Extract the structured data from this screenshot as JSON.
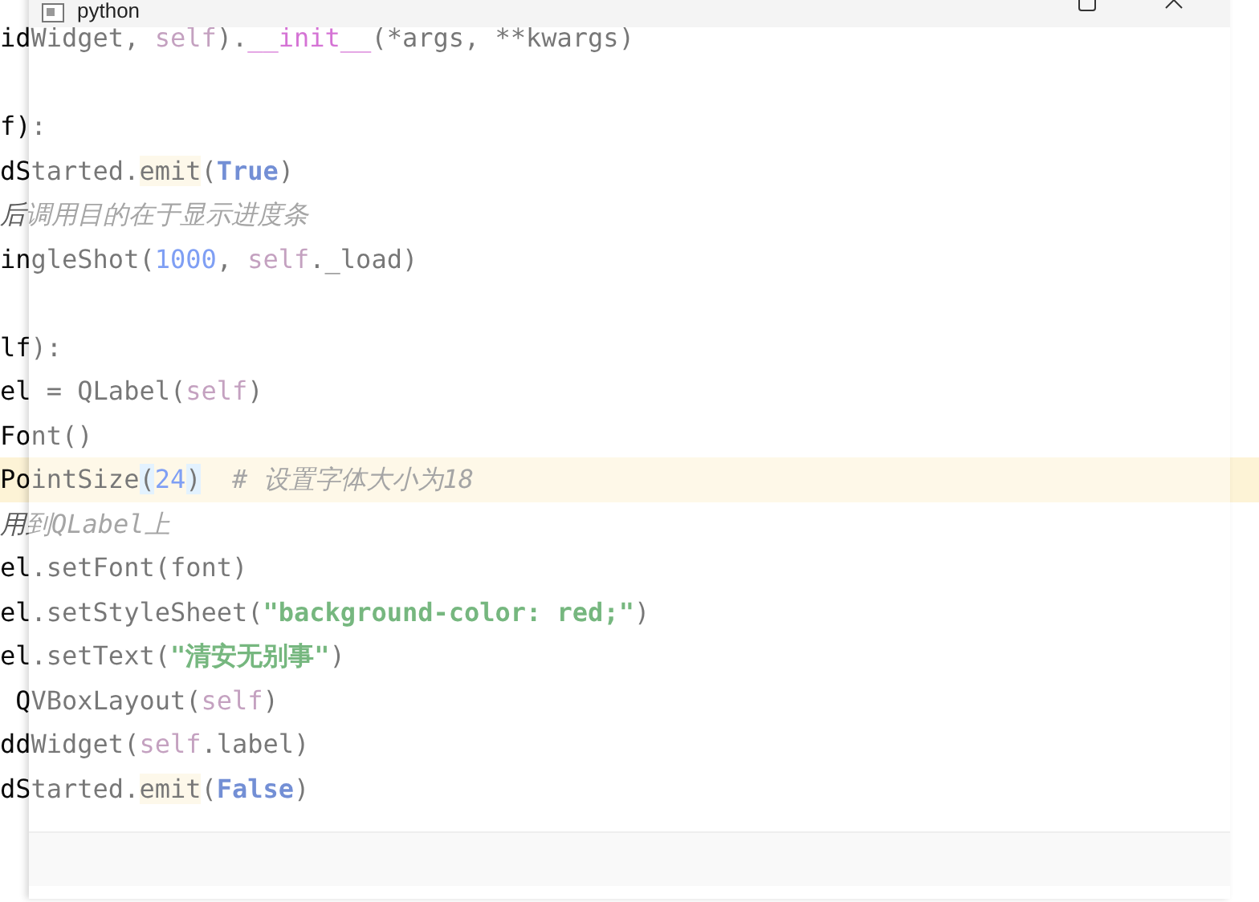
{
  "editor": {
    "blocks": [
      [
        {
          "current": false,
          "tokens": [
            {
              "text": "idWidget, ",
              "kind": "plain"
            },
            {
              "text": "self",
              "kind": "self"
            },
            {
              "text": ").",
              "kind": "plain"
            },
            {
              "text": "__init__",
              "kind": "magic"
            },
            {
              "text": "(*args, **kwargs)",
              "kind": "plain"
            }
          ]
        }
      ],
      [
        {
          "current": false,
          "tokens": [
            {
              "text": "f):",
              "kind": "plain"
            }
          ]
        },
        {
          "current": false,
          "tokens": [
            {
              "text": "dStarted.",
              "kind": "plain"
            },
            {
              "text": "emit",
              "kind": "usage"
            },
            {
              "text": "(",
              "kind": "plain"
            },
            {
              "text": "True",
              "kind": "keyword"
            },
            {
              "text": ")",
              "kind": "plain"
            }
          ]
        },
        {
          "current": false,
          "tokens": [
            {
              "text": "后调用目的在于显示进度条",
              "kind": "comment"
            }
          ]
        },
        {
          "current": false,
          "tokens": [
            {
              "text": "ingleShot(",
              "kind": "plain"
            },
            {
              "text": "1000",
              "kind": "number"
            },
            {
              "text": ", ",
              "kind": "plain"
            },
            {
              "text": "self",
              "kind": "self"
            },
            {
              "text": "._load)",
              "kind": "plain"
            }
          ]
        }
      ],
      [
        {
          "current": false,
          "tokens": [
            {
              "text": "lf):",
              "kind": "plain"
            }
          ]
        },
        {
          "current": false,
          "tokens": [
            {
              "text": "el = QLabel(",
              "kind": "plain"
            },
            {
              "text": "self",
              "kind": "self"
            },
            {
              "text": ")",
              "kind": "plain"
            }
          ]
        },
        {
          "current": false,
          "tokens": [
            {
              "text": "Font()",
              "kind": "plain"
            }
          ]
        },
        {
          "current": true,
          "tokens": [
            {
              "text": "PointSize",
              "kind": "plain"
            },
            {
              "text": "(",
              "kind": "brace"
            },
            {
              "text": "24",
              "kind": "number"
            },
            {
              "text": ")",
              "kind": "brace"
            },
            {
              "text": "  # 设置字体大小为18",
              "kind": "comment"
            }
          ]
        },
        {
          "current": false,
          "tokens": [
            {
              "text": "用到QLabel上",
              "kind": "comment"
            }
          ]
        },
        {
          "current": false,
          "tokens": [
            {
              "text": "el.setFont(font)",
              "kind": "plain"
            }
          ]
        },
        {
          "current": false,
          "tokens": [
            {
              "text": "el.setStyleSheet(",
              "kind": "plain"
            },
            {
              "text": "\"background-color: red;\"",
              "kind": "string"
            },
            {
              "text": ")",
              "kind": "plain"
            }
          ]
        },
        {
          "current": false,
          "tokens": [
            {
              "text": "el.setText(",
              "kind": "plain"
            },
            {
              "text": "\"清安无别事\"",
              "kind": "string"
            },
            {
              "text": ")",
              "kind": "plain"
            }
          ]
        },
        {
          "current": false,
          "tokens": [
            {
              "text": " QVBoxLayout(",
              "kind": "plain"
            },
            {
              "text": "self",
              "kind": "self"
            },
            {
              "text": ")",
              "kind": "plain"
            }
          ]
        },
        {
          "current": false,
          "tokens": [
            {
              "text": "ddWidget(",
              "kind": "plain"
            },
            {
              "text": "self",
              "kind": "self"
            },
            {
              "text": ".label)",
              "kind": "plain"
            }
          ]
        },
        {
          "current": false,
          "tokens": [
            {
              "text": "dStarted.",
              "kind": "plain"
            },
            {
              "text": "emit",
              "kind": "usage"
            },
            {
              "text": "(",
              "kind": "plain"
            },
            {
              "text": "False",
              "kind": "keyword"
            },
            {
              "text": ")",
              "kind": "plain"
            }
          ]
        }
      ]
    ]
  },
  "window": {
    "title": "python"
  }
}
